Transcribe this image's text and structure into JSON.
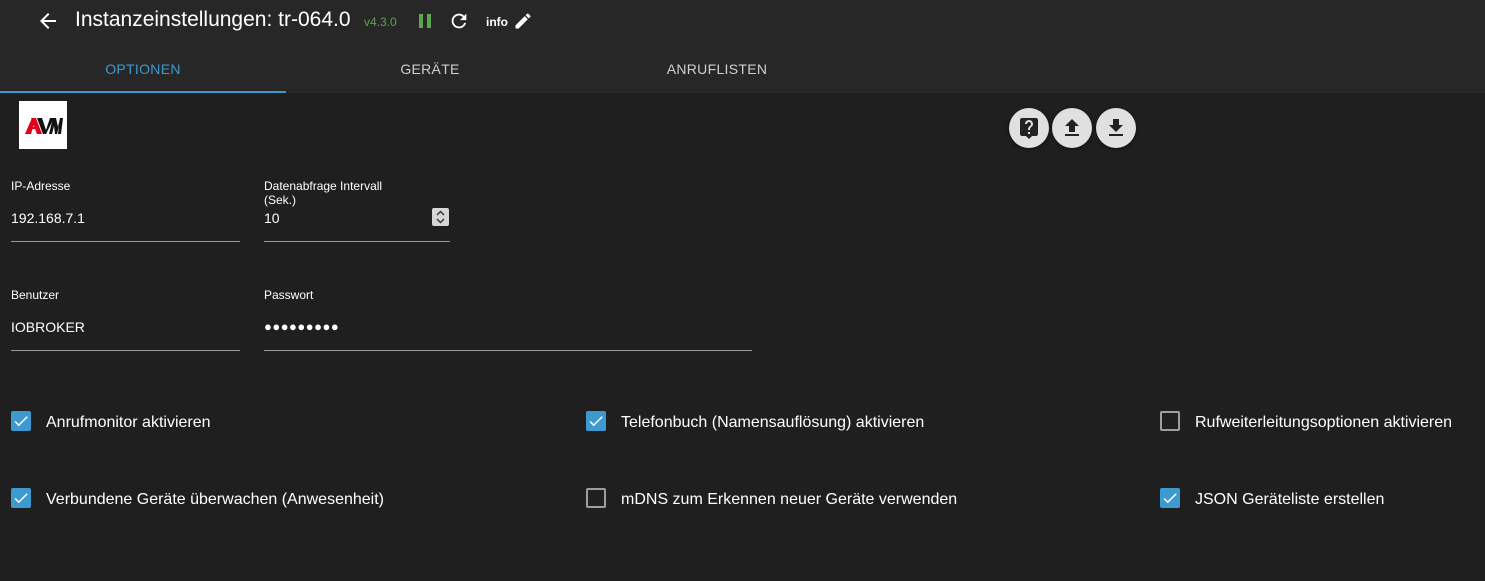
{
  "header": {
    "title": "Instanzeinstellungen: tr-064.0",
    "version": "v4.3.0",
    "loglevel": "info",
    "icons": [
      "arrow-back-icon",
      "pause-icon",
      "refresh-icon",
      "pencil-icon"
    ]
  },
  "tabs": [
    {
      "label": "OPTIONEN",
      "active": true
    },
    {
      "label": "GERÄTE",
      "active": false
    },
    {
      "label": "ANRUFLISTEN",
      "active": false
    }
  ],
  "logo": {
    "text": "AVM"
  },
  "actions": [
    "help-icon",
    "upload-icon",
    "download-icon"
  ],
  "fields": {
    "ip": {
      "label": "IP-Adresse",
      "value": "192.168.7.1"
    },
    "interval": {
      "label_line1": "Datenabfrage Intervall",
      "label_line2": "(Sek.)",
      "value": "10"
    },
    "user": {
      "label": "Benutzer",
      "value": "IOBROKER"
    },
    "password": {
      "label": "Passwort",
      "value": "●●●●●●●●●"
    }
  },
  "checkboxes": [
    {
      "label": "Anrufmonitor aktivieren",
      "checked": true
    },
    {
      "label": "Telefonbuch (Namensauflösung) aktivieren",
      "checked": true
    },
    {
      "label": "Rufweiterleitungsoptionen aktivieren",
      "checked": false
    },
    {
      "label": "Verbundene Geräte überwachen (Anwesenheit)",
      "checked": true
    },
    {
      "label": "mDNS zum Erkennen neuer Geräte verwenden",
      "checked": false
    },
    {
      "label": "JSON Geräteliste erstellen",
      "checked": true
    }
  ],
  "colors": {
    "accent": "#3d9ad1",
    "version": "#5da54f",
    "background": "#1f1f1f",
    "bar": "#272727"
  }
}
